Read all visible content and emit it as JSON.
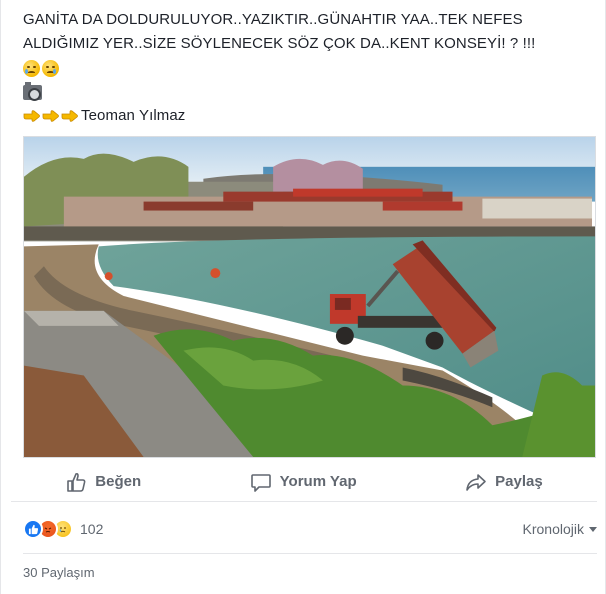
{
  "post": {
    "text_line1": "GANİTA DA DOLDURULUYOR..YAZIKTIR..GÜNAHTIR YAA..TEK NEFES",
    "text_line2": "ALDIĞIMIZ YER..SİZE SÖYLENECEK SÖZ ÇOK DA..KENT KONSEYİ! ? !!!",
    "emojis": [
      "sleepy-face-icon",
      "disappointed-relieved-face-icon"
    ],
    "camera_icon": "camera-icon",
    "pointing_icons": [
      "backhand-index-pointing-right-icon",
      "backhand-index-pointing-right-icon",
      "backhand-index-pointing-right-icon"
    ],
    "author": "Teoman Yılmaz"
  },
  "actions": {
    "like_label": "Beğen",
    "comment_label": "Yorum Yap",
    "share_label": "Paylaş"
  },
  "reactions": {
    "types": [
      "like",
      "angry",
      "sad"
    ],
    "count": "102",
    "sort_label": "Kronolojik"
  },
  "shares_label": "30 Paylaşım",
  "colors": {
    "text": "#1d2129",
    "secondary": "#606770",
    "like_blue": "#1877f2",
    "divider": "#e5e6e9"
  }
}
